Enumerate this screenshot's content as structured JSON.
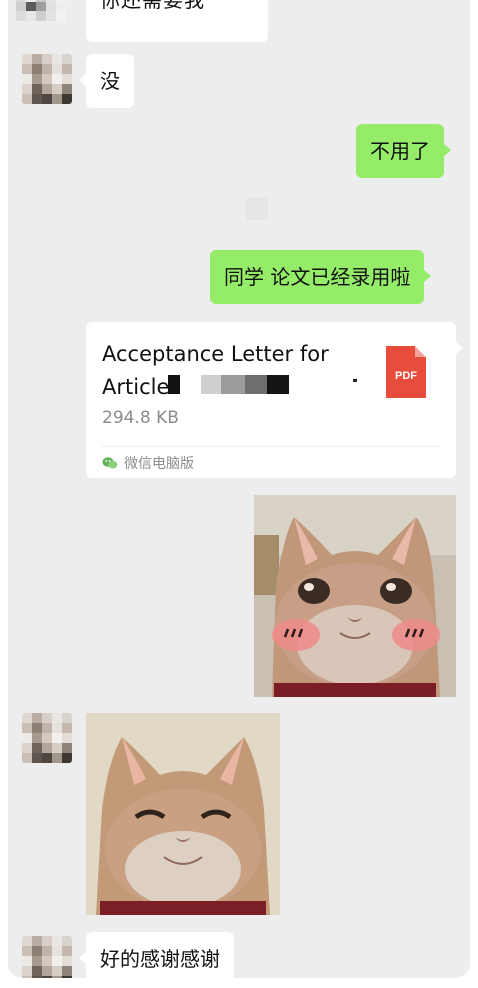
{
  "messages": {
    "cut_off_text": "你还需要我",
    "msg_no": "没",
    "msg_not_needed": "不用了",
    "msg_accepted": "同学 论文已经录用啦",
    "msg_thanks": "好的感谢感谢"
  },
  "file": {
    "title_line1": "Acceptance Letter for",
    "title_line2": "Article",
    "size": "294.8 KB",
    "source": "微信电脑版",
    "icon_text": "PDF",
    "icon_color": "#e84c3d"
  },
  "colors": {
    "outgoing_bubble": "#95ec69",
    "incoming_bubble": "#ffffff",
    "chat_background": "#ededed"
  },
  "stickers": {
    "sticker_1": "cat-blushing-sticker",
    "sticker_2": "cat-smiling-sticker"
  },
  "icons": {
    "file_icon": "pdf-file-icon",
    "source_icon": "wechat-icon"
  }
}
